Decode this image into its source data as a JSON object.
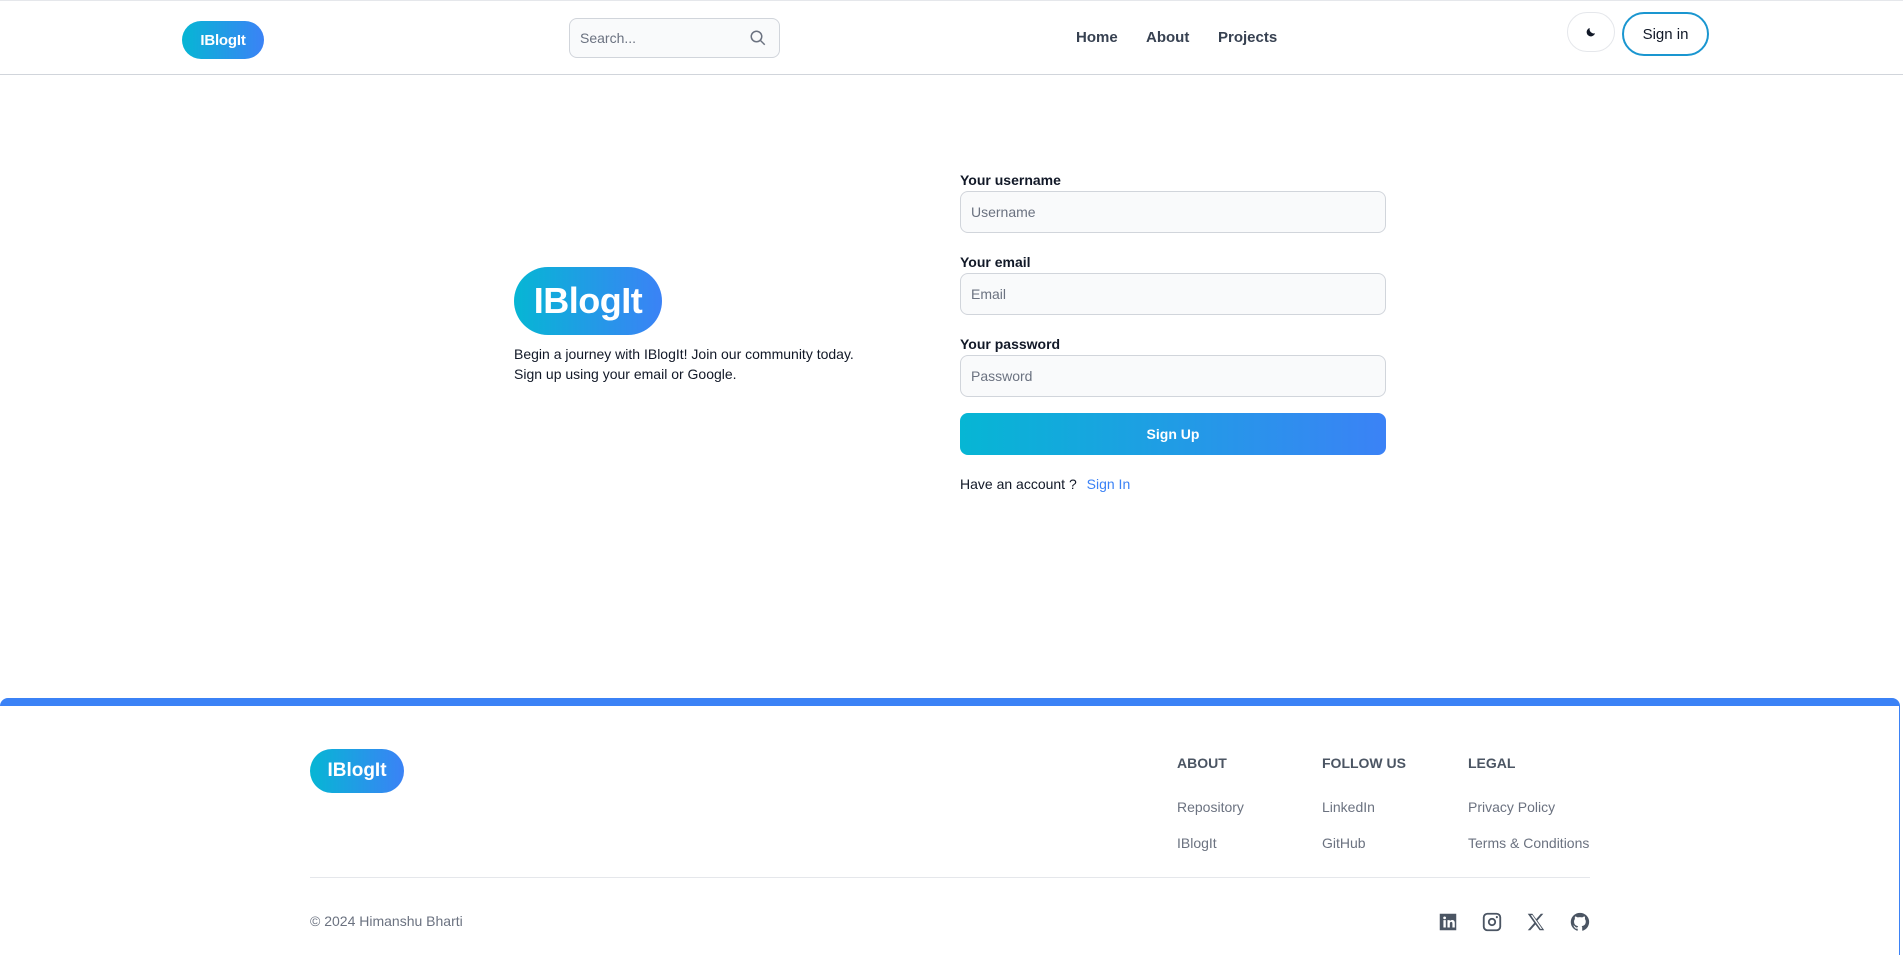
{
  "header": {
    "logo": "IBlogIt",
    "search": {
      "placeholder": "Search..."
    },
    "nav": [
      "Home",
      "About",
      "Projects"
    ],
    "theme_toggle_icon": "moon-icon",
    "signin_label": "Sign in"
  },
  "main": {
    "logo": "IBlogIt",
    "tagline_line1": "Begin a journey with IBlogIt! Join our community today.",
    "tagline_line2": "Sign up using your email or Google.",
    "form": {
      "username_label": "Your username",
      "username_placeholder": "Username",
      "email_label": "Your email",
      "email_placeholder": "Email",
      "password_label": "Your password",
      "password_placeholder": "Password",
      "submit_label": "Sign Up",
      "have_account_text": "Have an account ?",
      "signin_link": "Sign In"
    }
  },
  "footer": {
    "logo": "IBlogIt",
    "columns": [
      {
        "title": "ABOUT",
        "links": [
          "Repository",
          "IBlogIt"
        ]
      },
      {
        "title": "FOLLOW US",
        "links": [
          "LinkedIn",
          "GitHub"
        ]
      },
      {
        "title": "LEGAL",
        "links": [
          "Privacy Policy",
          "Terms & Conditions"
        ]
      }
    ],
    "copyright": "© 2024 Himanshu Bharti",
    "social_icons": [
      "linkedin-icon",
      "instagram-icon",
      "x-icon",
      "github-icon"
    ]
  },
  "colors": {
    "gradient_start": "#06b6d4",
    "gradient_end": "#3b82f6",
    "link": "#3b82f6",
    "signin_border": "#1a96d0"
  }
}
